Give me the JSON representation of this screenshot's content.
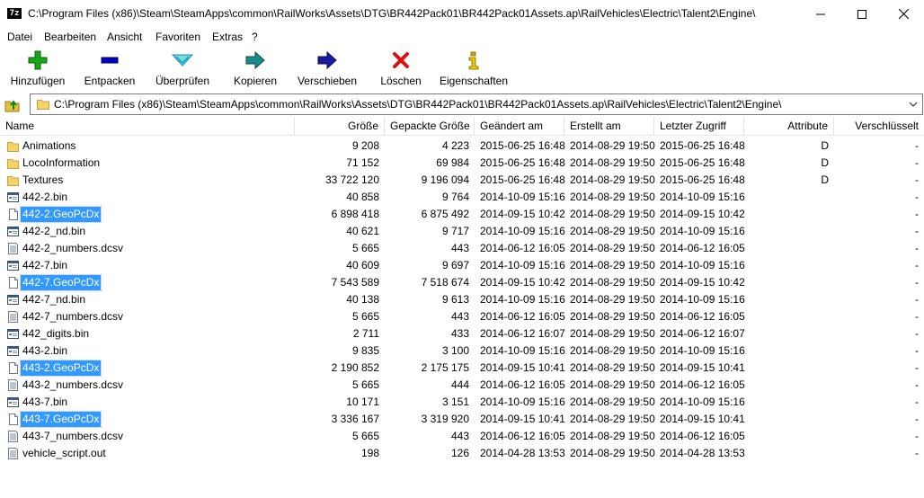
{
  "window": {
    "title": "C:\\Program Files (x86)\\Steam\\SteamApps\\common\\RailWorks\\Assets\\DTG\\BR442Pack01\\BR442Pack01Assets.ap\\RailVehicles\\Electric\\Talent2\\Engine\\",
    "app_icon_text": "7z"
  },
  "menu": [
    "Datei",
    "Bearbeiten",
    "Ansicht",
    "Favoriten",
    "Extras",
    "?"
  ],
  "toolbar": {
    "add": "Hinzufügen",
    "extract": "Entpacken",
    "test": "Überprüfen",
    "copy": "Kopieren",
    "move": "Verschieben",
    "delete": "Löschen",
    "info": "Eigenschaften"
  },
  "toolbar_colors": {
    "add": "#19a519",
    "extract": "#0000c0",
    "test": "#1ab0c8",
    "copy": "#1a8a8a",
    "move": "#1a1aa0",
    "delete": "#e01010",
    "info": "#d4a800"
  },
  "address": {
    "path": "C:\\Program Files (x86)\\Steam\\SteamApps\\common\\RailWorks\\Assets\\DTG\\BR442Pack01\\BR442Pack01Assets.ap\\RailVehicles\\Electric\\Talent2\\Engine\\"
  },
  "columns": {
    "name": "Name",
    "size": "Größe",
    "packed": "Gepackte Größe",
    "modified": "Geändert am",
    "created": "Erstellt am",
    "accessed": "Letzter Zugriff",
    "attributes": "Attribute",
    "encrypted": "Verschlüsselt"
  },
  "files": [
    {
      "icon": "folder-icon",
      "name": "Animations",
      "size": "9 208",
      "packed": "4 223",
      "modified": "2015-06-25 16:48",
      "created": "2014-08-29 19:50",
      "accessed": "2015-06-25 16:48",
      "attr": "D",
      "enc": "-",
      "selected": false
    },
    {
      "icon": "folder-icon",
      "name": "LocoInformation",
      "size": "71 152",
      "packed": "69 984",
      "modified": "2015-06-25 16:48",
      "created": "2014-08-29 19:50",
      "accessed": "2015-06-25 16:48",
      "attr": "D",
      "enc": "-",
      "selected": false
    },
    {
      "icon": "folder-icon",
      "name": "Textures",
      "size": "33 722 120",
      "packed": "9 196 094",
      "modified": "2015-06-25 16:48",
      "created": "2014-08-29 19:50",
      "accessed": "2015-06-25 16:48",
      "attr": "D",
      "enc": "-",
      "selected": false
    },
    {
      "icon": "bin-file-icon",
      "name": "442-2.bin",
      "size": "40 858",
      "packed": "9 764",
      "modified": "2014-10-09 15:16",
      "created": "2014-08-29 19:50",
      "accessed": "2014-10-09 15:16",
      "attr": "",
      "enc": "-",
      "selected": false
    },
    {
      "icon": "generic-file-icon",
      "name": "442-2.GeoPcDx",
      "size": "6 898 418",
      "packed": "6 875 492",
      "modified": "2014-09-15 10:42",
      "created": "2014-08-29 19:50",
      "accessed": "2014-09-15 10:42",
      "attr": "",
      "enc": "-",
      "selected": true
    },
    {
      "icon": "bin-file-icon",
      "name": "442-2_nd.bin",
      "size": "40 621",
      "packed": "9 717",
      "modified": "2014-10-09 15:16",
      "created": "2014-08-29 19:50",
      "accessed": "2014-10-09 15:16",
      "attr": "",
      "enc": "-",
      "selected": false
    },
    {
      "icon": "text-file-icon",
      "name": "442-2_numbers.dcsv",
      "size": "5 665",
      "packed": "443",
      "modified": "2014-06-12 16:05",
      "created": "2014-08-29 19:50",
      "accessed": "2014-06-12 16:05",
      "attr": "",
      "enc": "-",
      "selected": false
    },
    {
      "icon": "bin-file-icon",
      "name": "442-7.bin",
      "size": "40 609",
      "packed": "9 697",
      "modified": "2014-10-09 15:16",
      "created": "2014-08-29 19:50",
      "accessed": "2014-10-09 15:16",
      "attr": "",
      "enc": "-",
      "selected": false
    },
    {
      "icon": "generic-file-icon",
      "name": "442-7.GeoPcDx",
      "size": "7 543 589",
      "packed": "7 518 674",
      "modified": "2014-09-15 10:42",
      "created": "2014-08-29 19:50",
      "accessed": "2014-09-15 10:42",
      "attr": "",
      "enc": "-",
      "selected": true
    },
    {
      "icon": "bin-file-icon",
      "name": "442-7_nd.bin",
      "size": "40 138",
      "packed": "9 613",
      "modified": "2014-10-09 15:16",
      "created": "2014-08-29 19:50",
      "accessed": "2014-10-09 15:16",
      "attr": "",
      "enc": "-",
      "selected": false
    },
    {
      "icon": "text-file-icon",
      "name": "442-7_numbers.dcsv",
      "size": "5 665",
      "packed": "443",
      "modified": "2014-06-12 16:05",
      "created": "2014-08-29 19:50",
      "accessed": "2014-06-12 16:05",
      "attr": "",
      "enc": "-",
      "selected": false
    },
    {
      "icon": "bin-file-icon",
      "name": "442_digits.bin",
      "size": "2 711",
      "packed": "433",
      "modified": "2014-06-12 16:07",
      "created": "2014-08-29 19:50",
      "accessed": "2014-06-12 16:07",
      "attr": "",
      "enc": "-",
      "selected": false
    },
    {
      "icon": "bin-file-icon",
      "name": "443-2.bin",
      "size": "9 835",
      "packed": "3 100",
      "modified": "2014-10-09 15:16",
      "created": "2014-08-29 19:50",
      "accessed": "2014-10-09 15:16",
      "attr": "",
      "enc": "-",
      "selected": false
    },
    {
      "icon": "generic-file-icon",
      "name": "443-2.GeoPcDx",
      "size": "2 190 852",
      "packed": "2 175 175",
      "modified": "2014-09-15 10:41",
      "created": "2014-08-29 19:50",
      "accessed": "2014-09-15 10:41",
      "attr": "",
      "enc": "-",
      "selected": true
    },
    {
      "icon": "text-file-icon",
      "name": "443-2_numbers.dcsv",
      "size": "5 665",
      "packed": "444",
      "modified": "2014-06-12 16:05",
      "created": "2014-08-29 19:50",
      "accessed": "2014-06-12 16:05",
      "attr": "",
      "enc": "-",
      "selected": false
    },
    {
      "icon": "bin-file-icon",
      "name": "443-7.bin",
      "size": "10 171",
      "packed": "3 151",
      "modified": "2014-10-09 15:16",
      "created": "2014-08-29 19:50",
      "accessed": "2014-10-09 15:16",
      "attr": "",
      "enc": "-",
      "selected": false
    },
    {
      "icon": "generic-file-icon",
      "name": "443-7.GeoPcDx",
      "size": "3 336 167",
      "packed": "3 319 920",
      "modified": "2014-09-15 10:41",
      "created": "2014-08-29 19:50",
      "accessed": "2014-09-15 10:41",
      "attr": "",
      "enc": "-",
      "selected": true
    },
    {
      "icon": "text-file-icon",
      "name": "443-7_numbers.dcsv",
      "size": "5 665",
      "packed": "443",
      "modified": "2014-06-12 16:05",
      "created": "2014-08-29 19:50",
      "accessed": "2014-06-12 16:05",
      "attr": "",
      "enc": "-",
      "selected": false
    },
    {
      "icon": "text-file-icon",
      "name": "vehicle_script.out",
      "size": "198",
      "packed": "126",
      "modified": "2014-04-28 13:53",
      "created": "2014-08-29 19:50",
      "accessed": "2014-04-28 13:53",
      "attr": "",
      "enc": "-",
      "selected": false
    }
  ]
}
